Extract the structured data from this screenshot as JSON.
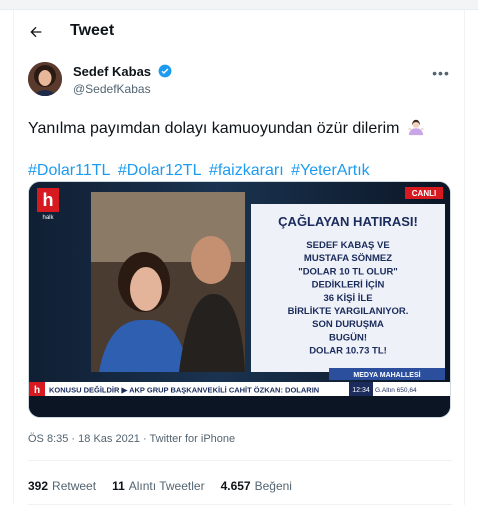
{
  "header": {
    "title": "Tweet"
  },
  "author": {
    "name": "Sedef Kabas",
    "handle": "@SedefKabas"
  },
  "tweet": {
    "text": "Yanılma payımdan dolayı kamuoyundan özür dilerim",
    "hashtags": [
      "#Dolar11TL",
      "#Dolar12TL",
      "#faizkararı",
      "#YeterArtık"
    ]
  },
  "media": {
    "channel_logo": "h",
    "channel_sub": "halk",
    "live_badge": "CANLI",
    "headline": "ÇAĞLAYAN HATIRASI!",
    "body_lines": [
      "SEDEF KABAŞ VE",
      "MUSTAFA SÖNMEZ",
      "\"DOLAR 10 TL OLUR\"",
      "DEDİKLERİ İÇİN",
      "36 KİŞİ İLE",
      "BİRLİKTE YARGILANIYOR.",
      "SON DURUŞMA",
      "BUGÜN!",
      "DOLAR 10.73 TL!"
    ],
    "program": "MEDYA MAHALLESİ",
    "ticker": "KONUSU DEĞİLDİR ▶ AKP GRUP BAŞKANVEKİLİ CAHİT ÖZKAN: DOLARIN",
    "clock": "12:34",
    "gold": "G.Altın 650,64"
  },
  "meta": {
    "time": "ÖS 8:35",
    "date": "18 Kas 2021",
    "source": "Twitter for iPhone"
  },
  "stats": {
    "retweets": "392",
    "retweets_label": "Retweet",
    "quotes": "11",
    "quotes_label": "Alıntı Tweetler",
    "likes": "4.657",
    "likes_label": "Beğeni"
  },
  "colors": {
    "link": "#1d9bf0",
    "verified": "#1d9bf0",
    "live_red": "#d71920",
    "banner_text": "#1a2b5c"
  }
}
